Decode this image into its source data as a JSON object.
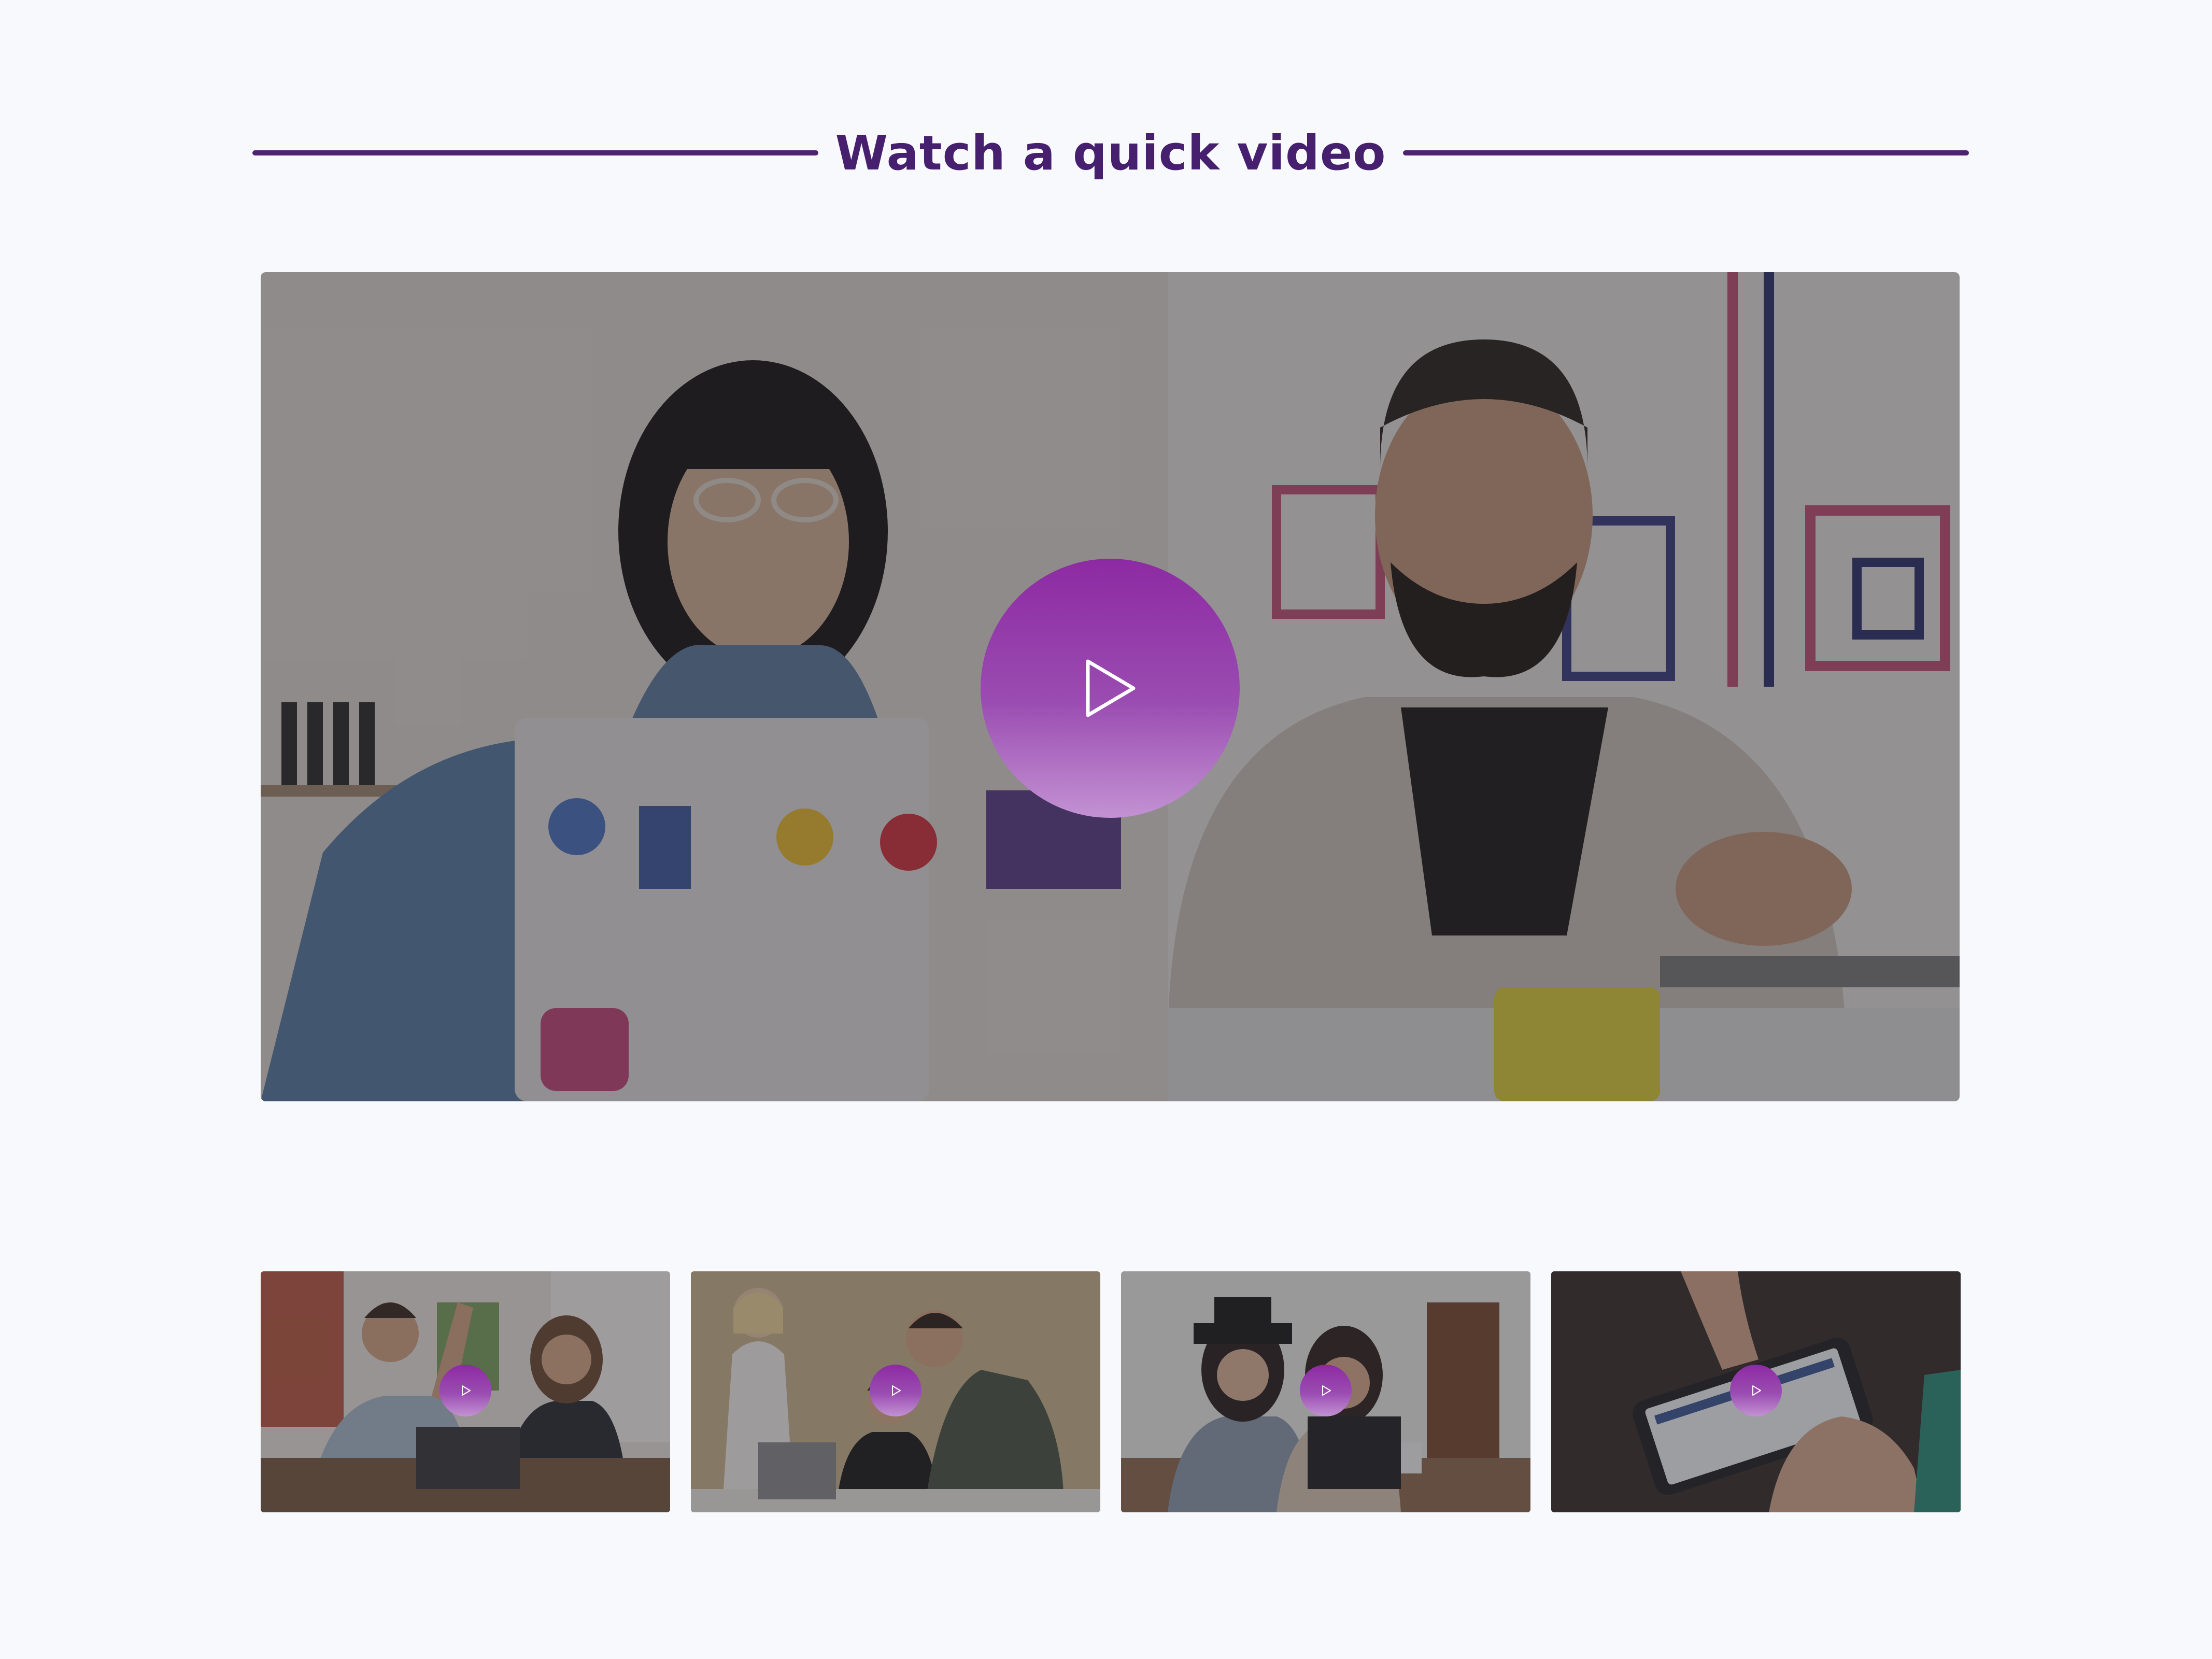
{
  "section": {
    "title": "Watch a quick video"
  },
  "colors": {
    "accent": "#4e2271",
    "play_gradient_top": "#8d2aa3",
    "play_gradient_bottom": "#c392d3",
    "background": "#f8f9fc"
  },
  "main_video": {
    "play_icon": "play-icon"
  },
  "thumbnails": [
    {
      "play_icon": "play-icon"
    },
    {
      "play_icon": "play-icon"
    },
    {
      "play_icon": "play-icon"
    },
    {
      "play_icon": "play-icon"
    }
  ]
}
